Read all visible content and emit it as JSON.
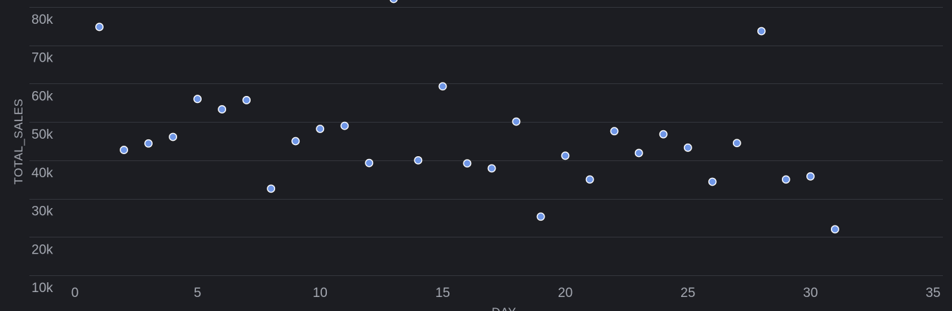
{
  "chart_data": {
    "type": "scatter",
    "title": "",
    "xlabel": "DAY",
    "ylabel": "TOTAL_SALES",
    "xlim": [
      0,
      35
    ],
    "ylim": [
      10000,
      80000
    ],
    "xticks": [
      0,
      5,
      10,
      15,
      20,
      25,
      30,
      35
    ],
    "xtick_labels": [
      "0",
      "5",
      "10",
      "15",
      "20",
      "25",
      "30",
      "35"
    ],
    "yticks": [
      10000,
      20000,
      30000,
      40000,
      50000,
      60000,
      70000,
      80000
    ],
    "ytick_labels": [
      "10k",
      "20k",
      "30k",
      "40k",
      "50k",
      "60k",
      "70k",
      "80k"
    ],
    "grid": true,
    "marker_color": "#6f96e6",
    "series": [
      {
        "x": [
          1,
          2,
          3,
          4,
          5,
          6,
          7,
          8,
          9,
          10,
          11,
          12,
          13,
          14,
          15,
          16,
          17,
          18,
          19,
          20,
          21,
          22,
          23,
          24,
          25,
          26,
          27,
          28,
          29,
          30,
          31
        ],
        "y": [
          74800,
          42700,
          44400,
          46100,
          56000,
          53300,
          55700,
          32600,
          45000,
          48200,
          49000,
          39300,
          82100,
          40000,
          59300,
          39200,
          37900,
          50100,
          25300,
          41200,
          35000,
          47600,
          41900,
          46800,
          43300,
          34400,
          44500,
          73700,
          35000,
          35800,
          22000
        ]
      }
    ]
  }
}
